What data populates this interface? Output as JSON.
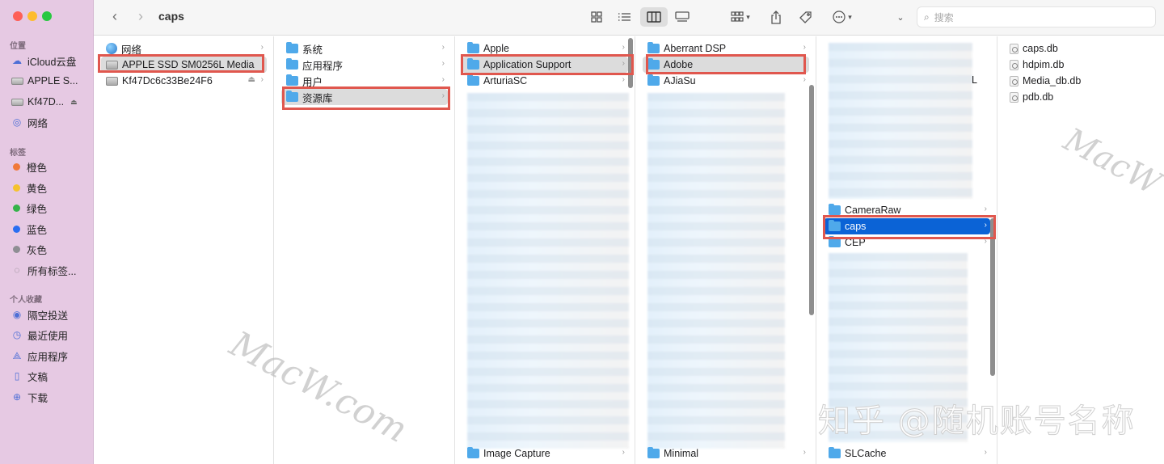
{
  "window": {
    "title": "caps"
  },
  "sidebar": {
    "sections": {
      "locations": "位置",
      "tags": "标签",
      "favorites": "个人收藏"
    },
    "locations": [
      {
        "label": "iCloud云盘",
        "icon": "cloud-icon"
      },
      {
        "label": "APPLE S...",
        "icon": "disk-icon"
      },
      {
        "label": "Kf47D...",
        "icon": "disk-icon",
        "eject": "⏏"
      },
      {
        "label": "网络",
        "icon": "globe-icon"
      }
    ],
    "tags": [
      {
        "label": "橙色",
        "color": "#f0793a"
      },
      {
        "label": "黄色",
        "color": "#f5c22e"
      },
      {
        "label": "绿色",
        "color": "#35b34a"
      },
      {
        "label": "蓝色",
        "color": "#2a6ef1"
      },
      {
        "label": "灰色",
        "color": "#8e8e93"
      },
      {
        "label": "所有标签..."
      }
    ],
    "favorites": [
      {
        "label": "隔空投送",
        "icon": "airdrop-icon"
      },
      {
        "label": "最近使用",
        "icon": "clock-icon"
      },
      {
        "label": "应用程序",
        "icon": "applications-icon"
      },
      {
        "label": "文稿",
        "icon": "document-icon"
      },
      {
        "label": "下载",
        "icon": "download-icon"
      }
    ]
  },
  "toolbar": {
    "search_placeholder": "搜索"
  },
  "columns": {
    "col1": [
      "网络",
      "APPLE SSD SM0256L Media",
      "Kf47Dc6c33Be24F6"
    ],
    "col2": [
      "系统",
      "应用程序",
      "用户",
      "资源库"
    ],
    "col3_top": [
      "Apple",
      "Application Support",
      "ArturiaSC"
    ],
    "col3_bottom": "Image Capture",
    "col4_top": [
      "Aberrant DSP",
      "Adobe",
      "AJiaSu"
    ],
    "col4_bottom": "Minimal",
    "col5_items": [
      "CameraRaw",
      "caps",
      "CEP"
    ],
    "col5_bottom": "SLCache",
    "col5_partial": "L",
    "col6": [
      "caps.db",
      "hdpim.db",
      "Media_db.db",
      "pdb.db"
    ]
  },
  "watermarks": {
    "macw_center": "MacW.com",
    "macw_right": "MacW",
    "zhihu": "知乎 @随机账号名称"
  },
  "colors": {
    "sidebar_bg": "#e6c9e3",
    "selection_blue": "#0b63d6",
    "highlight_red": "#e0574e",
    "folder_blue": "#4fa9ea"
  }
}
